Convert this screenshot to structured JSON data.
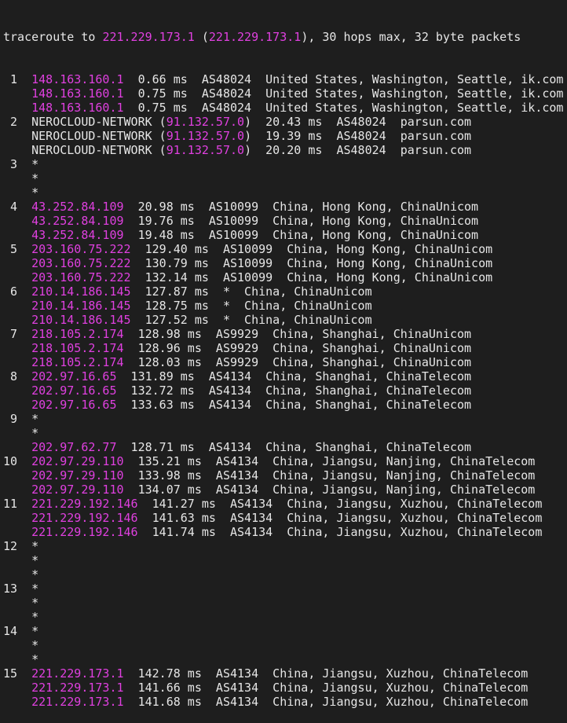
{
  "colors": {
    "background": "#1e1e1e",
    "text": "#e6e6e6",
    "ip_highlight": "#e040e0"
  },
  "header": {
    "prefix": "traceroute to ",
    "target_ip": "221.229.173.1",
    "open_paren": " (",
    "target_ip_paren": "221.229.173.1",
    "suffix": "), 30 hops max, 32 byte packets"
  },
  "lines": [
    {
      "pre": " 1  ",
      "ip": "148.163.160.1",
      "post": "  0.66 ms  AS48024  United States, Washington, Seattle, ik.com"
    },
    {
      "pre": "    ",
      "ip": "148.163.160.1",
      "post": "  0.75 ms  AS48024  United States, Washington, Seattle, ik.com"
    },
    {
      "pre": "    ",
      "ip": "148.163.160.1",
      "post": "  0.75 ms  AS48024  United States, Washington, Seattle, ik.com"
    },
    {
      "pre": " 2  NEROCLOUD-NETWORK (",
      "ip": "91.132.57.0",
      "post": ")  20.43 ms  AS48024  parsun.com"
    },
    {
      "pre": "    NEROCLOUD-NETWORK (",
      "ip": "91.132.57.0",
      "post": ")  19.39 ms  AS48024  parsun.com"
    },
    {
      "pre": "    NEROCLOUD-NETWORK (",
      "ip": "91.132.57.0",
      "post": ")  20.20 ms  AS48024  parsun.com"
    },
    {
      "pre": " 3  *",
      "ip": "",
      "post": ""
    },
    {
      "pre": "    *",
      "ip": "",
      "post": ""
    },
    {
      "pre": "    *",
      "ip": "",
      "post": ""
    },
    {
      "pre": " 4  ",
      "ip": "43.252.84.109",
      "post": "  20.98 ms  AS10099  China, Hong Kong, ChinaUnicom"
    },
    {
      "pre": "    ",
      "ip": "43.252.84.109",
      "post": "  19.76 ms  AS10099  China, Hong Kong, ChinaUnicom"
    },
    {
      "pre": "    ",
      "ip": "43.252.84.109",
      "post": "  19.48 ms  AS10099  China, Hong Kong, ChinaUnicom"
    },
    {
      "pre": " 5  ",
      "ip": "203.160.75.222",
      "post": "  129.40 ms  AS10099  China, Hong Kong, ChinaUnicom"
    },
    {
      "pre": "    ",
      "ip": "203.160.75.222",
      "post": "  130.79 ms  AS10099  China, Hong Kong, ChinaUnicom"
    },
    {
      "pre": "    ",
      "ip": "203.160.75.222",
      "post": "  132.14 ms  AS10099  China, Hong Kong, ChinaUnicom"
    },
    {
      "pre": " 6  ",
      "ip": "210.14.186.145",
      "post": "  127.87 ms  *  China, ChinaUnicom"
    },
    {
      "pre": "    ",
      "ip": "210.14.186.145",
      "post": "  128.75 ms  *  China, ChinaUnicom"
    },
    {
      "pre": "    ",
      "ip": "210.14.186.145",
      "post": "  127.52 ms  *  China, ChinaUnicom"
    },
    {
      "pre": " 7  ",
      "ip": "218.105.2.174",
      "post": "  128.98 ms  AS9929  China, Shanghai, ChinaUnicom"
    },
    {
      "pre": "    ",
      "ip": "218.105.2.174",
      "post": "  128.96 ms  AS9929  China, Shanghai, ChinaUnicom"
    },
    {
      "pre": "    ",
      "ip": "218.105.2.174",
      "post": "  128.03 ms  AS9929  China, Shanghai, ChinaUnicom"
    },
    {
      "pre": " 8  ",
      "ip": "202.97.16.65",
      "post": "  131.89 ms  AS4134  China, Shanghai, ChinaTelecom"
    },
    {
      "pre": "    ",
      "ip": "202.97.16.65",
      "post": "  132.72 ms  AS4134  China, Shanghai, ChinaTelecom"
    },
    {
      "pre": "    ",
      "ip": "202.97.16.65",
      "post": "  133.63 ms  AS4134  China, Shanghai, ChinaTelecom"
    },
    {
      "pre": " 9  *",
      "ip": "",
      "post": ""
    },
    {
      "pre": "    *",
      "ip": "",
      "post": ""
    },
    {
      "pre": "    ",
      "ip": "202.97.62.77",
      "post": "  128.71 ms  AS4134  China, Shanghai, ChinaTelecom"
    },
    {
      "pre": "10  ",
      "ip": "202.97.29.110",
      "post": "  135.21 ms  AS4134  China, Jiangsu, Nanjing, ChinaTelecom"
    },
    {
      "pre": "    ",
      "ip": "202.97.29.110",
      "post": "  133.98 ms  AS4134  China, Jiangsu, Nanjing, ChinaTelecom"
    },
    {
      "pre": "    ",
      "ip": "202.97.29.110",
      "post": "  134.07 ms  AS4134  China, Jiangsu, Nanjing, ChinaTelecom"
    },
    {
      "pre": "11  ",
      "ip": "221.229.192.146",
      "post": "  141.27 ms  AS4134  China, Jiangsu, Xuzhou, ChinaTelecom"
    },
    {
      "pre": "    ",
      "ip": "221.229.192.146",
      "post": "  141.63 ms  AS4134  China, Jiangsu, Xuzhou, ChinaTelecom"
    },
    {
      "pre": "    ",
      "ip": "221.229.192.146",
      "post": "  141.74 ms  AS4134  China, Jiangsu, Xuzhou, ChinaTelecom"
    },
    {
      "pre": "12  *",
      "ip": "",
      "post": ""
    },
    {
      "pre": "    *",
      "ip": "",
      "post": ""
    },
    {
      "pre": "    *",
      "ip": "",
      "post": ""
    },
    {
      "pre": "13  *",
      "ip": "",
      "post": ""
    },
    {
      "pre": "    *",
      "ip": "",
      "post": ""
    },
    {
      "pre": "    *",
      "ip": "",
      "post": ""
    },
    {
      "pre": "14  *",
      "ip": "",
      "post": ""
    },
    {
      "pre": "    *",
      "ip": "",
      "post": ""
    },
    {
      "pre": "    *",
      "ip": "",
      "post": ""
    },
    {
      "pre": "15  ",
      "ip": "221.229.173.1",
      "post": "  142.78 ms  AS4134  China, Jiangsu, Xuzhou, ChinaTelecom"
    },
    {
      "pre": "    ",
      "ip": "221.229.173.1",
      "post": "  141.66 ms  AS4134  China, Jiangsu, Xuzhou, ChinaTelecom"
    },
    {
      "pre": "    ",
      "ip": "221.229.173.1",
      "post": "  141.68 ms  AS4134  China, Jiangsu, Xuzhou, ChinaTelecom"
    }
  ]
}
